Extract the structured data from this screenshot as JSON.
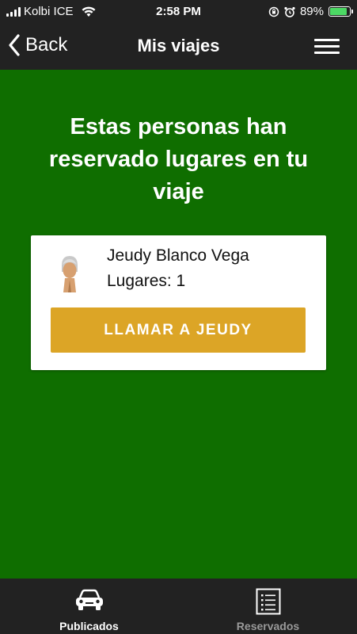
{
  "status_bar": {
    "carrier": "Kolbi ICE",
    "time": "2:58 PM",
    "battery_percent": "89%",
    "battery_level": 0.89,
    "icons": [
      "signal-icon",
      "wifi-icon",
      "orientation-lock-icon",
      "alarm-icon",
      "battery-icon"
    ]
  },
  "nav": {
    "back_label": "Back",
    "title": "Mis viajes",
    "menu_icon": "hamburger-menu-icon"
  },
  "main": {
    "heading": "Estas personas han reservado lugares en tu viaje",
    "reservations": [
      {
        "name": "Jeudy Blanco Vega",
        "seats": "Lugares: 1",
        "avatar_icon": "person-avatar-icon",
        "call_label": "LLAMAR A JEUDY"
      }
    ]
  },
  "tabs": [
    {
      "label": "Publicados",
      "icon": "car-icon",
      "active": true
    },
    {
      "label": "Reservados",
      "icon": "list-icon",
      "active": false
    }
  ],
  "colors": {
    "background": "#0f6e00",
    "bars": "#222222",
    "call_button": "#dca526",
    "card": "#ffffff",
    "battery": "#4cd964"
  }
}
